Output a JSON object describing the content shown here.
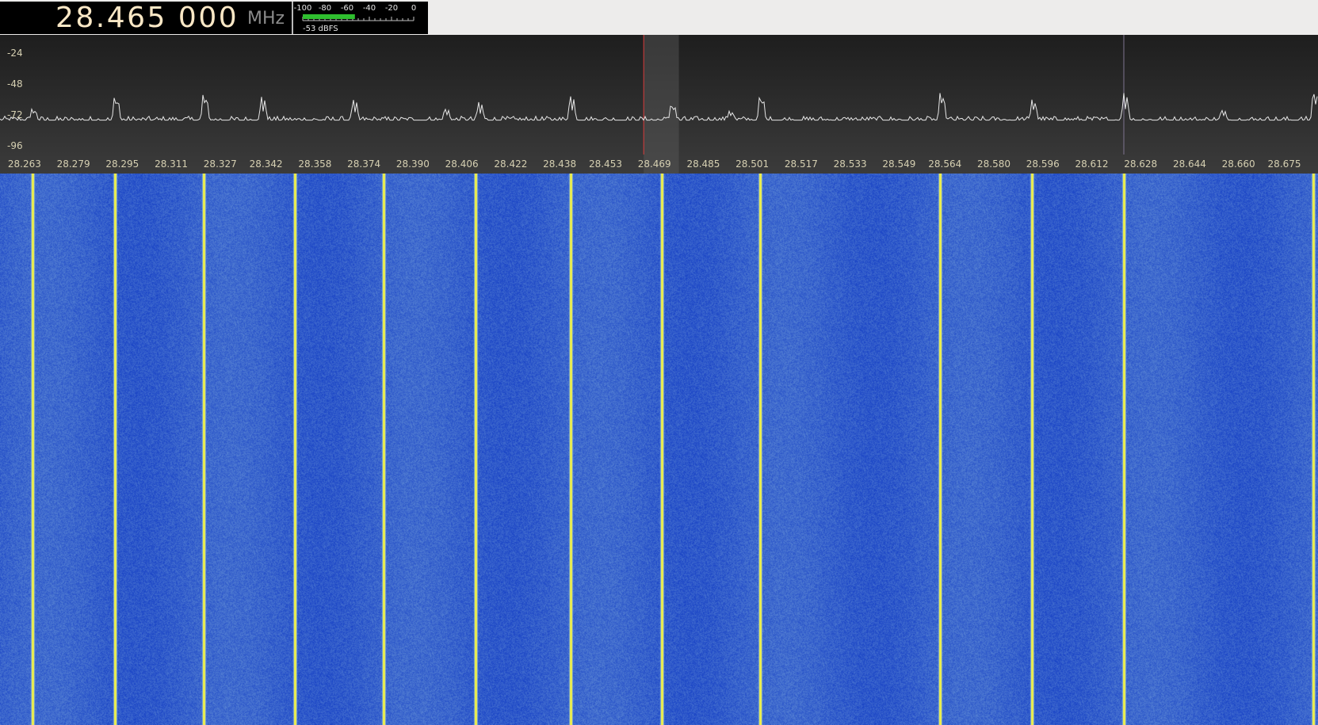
{
  "frequency": {
    "digits": "28.465 000",
    "unit": "MHz"
  },
  "signal_meter": {
    "scale": [
      "-100",
      "-80",
      "-60",
      "-40",
      "-20",
      "0"
    ],
    "readout": "-53 dBFS",
    "level_fraction": 0.47,
    "bar_color": "#2fbf2f"
  },
  "spectrum": {
    "db_labels": [
      "-24",
      "-48",
      "-72",
      "-96"
    ],
    "freq_labels": [
      "28.263",
      "28.279",
      "28.295",
      "28.311",
      "28.327",
      "28.342",
      "28.358",
      "28.374",
      "28.390",
      "28.406",
      "28.422",
      "28.438",
      "28.453",
      "28.469",
      "28.485",
      "28.501",
      "28.517",
      "28.533",
      "28.549",
      "28.564",
      "28.580",
      "28.596",
      "28.612",
      "28.628",
      "28.644",
      "28.660",
      "28.675"
    ],
    "trace_color": "#e6e6e6",
    "marker_color": "#d83a3a",
    "bg_top": "#202020",
    "bg_bottom": "#3a3a3a"
  },
  "chart_data": {
    "type": "line",
    "title": "",
    "xlabel": "",
    "ylabel": "",
    "x_unit": "MHz",
    "y_unit": "dB",
    "xlim": [
      28.255,
      28.686
    ],
    "ylim": [
      -110,
      -10
    ],
    "noise_floor": -76,
    "peaks": [
      {
        "x": 28.2655,
        "y": -67
      },
      {
        "x": 28.2925,
        "y": -57
      },
      {
        "x": 28.3215,
        "y": -55
      },
      {
        "x": 28.3405,
        "y": -58
      },
      {
        "x": 28.3705,
        "y": -60
      },
      {
        "x": 28.4005,
        "y": -67
      },
      {
        "x": 28.4115,
        "y": -62
      },
      {
        "x": 28.4415,
        "y": -57
      },
      {
        "x": 28.4745,
        "y": -63
      },
      {
        "x": 28.4935,
        "y": -69
      },
      {
        "x": 28.5035,
        "y": -56
      },
      {
        "x": 28.5625,
        "y": -54
      },
      {
        "x": 28.5925,
        "y": -60
      },
      {
        "x": 28.6225,
        "y": -55
      },
      {
        "x": 28.6545,
        "y": -68
      },
      {
        "x": 28.6845,
        "y": -53
      }
    ],
    "markers": [
      28.4655,
      28.6225
    ],
    "waterfall_carriers": [
      28.2655,
      28.2925,
      28.3215,
      28.3515,
      28.3805,
      28.4105,
      28.4415,
      28.4715,
      28.5035,
      28.5625,
      28.5925,
      28.6225,
      28.6845
    ]
  },
  "waterfall": {
    "color_low": "#1c46c6",
    "color_high": "#eff04a"
  }
}
